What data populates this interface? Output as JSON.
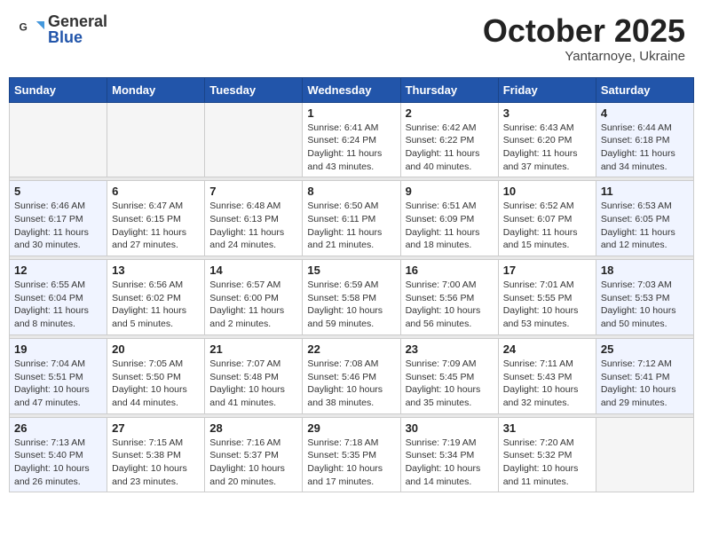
{
  "header": {
    "logo_general": "General",
    "logo_blue": "Blue",
    "month_title": "October 2025",
    "subtitle": "Yantarnoye, Ukraine"
  },
  "days_of_week": [
    "Sunday",
    "Monday",
    "Tuesday",
    "Wednesday",
    "Thursday",
    "Friday",
    "Saturday"
  ],
  "weeks": [
    [
      {
        "day": "",
        "info": ""
      },
      {
        "day": "",
        "info": ""
      },
      {
        "day": "",
        "info": ""
      },
      {
        "day": "1",
        "info": "Sunrise: 6:41 AM\nSunset: 6:24 PM\nDaylight: 11 hours\nand 43 minutes."
      },
      {
        "day": "2",
        "info": "Sunrise: 6:42 AM\nSunset: 6:22 PM\nDaylight: 11 hours\nand 40 minutes."
      },
      {
        "day": "3",
        "info": "Sunrise: 6:43 AM\nSunset: 6:20 PM\nDaylight: 11 hours\nand 37 minutes."
      },
      {
        "day": "4",
        "info": "Sunrise: 6:44 AM\nSunset: 6:18 PM\nDaylight: 11 hours\nand 34 minutes."
      }
    ],
    [
      {
        "day": "5",
        "info": "Sunrise: 6:46 AM\nSunset: 6:17 PM\nDaylight: 11 hours\nand 30 minutes."
      },
      {
        "day": "6",
        "info": "Sunrise: 6:47 AM\nSunset: 6:15 PM\nDaylight: 11 hours\nand 27 minutes."
      },
      {
        "day": "7",
        "info": "Sunrise: 6:48 AM\nSunset: 6:13 PM\nDaylight: 11 hours\nand 24 minutes."
      },
      {
        "day": "8",
        "info": "Sunrise: 6:50 AM\nSunset: 6:11 PM\nDaylight: 11 hours\nand 21 minutes."
      },
      {
        "day": "9",
        "info": "Sunrise: 6:51 AM\nSunset: 6:09 PM\nDaylight: 11 hours\nand 18 minutes."
      },
      {
        "day": "10",
        "info": "Sunrise: 6:52 AM\nSunset: 6:07 PM\nDaylight: 11 hours\nand 15 minutes."
      },
      {
        "day": "11",
        "info": "Sunrise: 6:53 AM\nSunset: 6:05 PM\nDaylight: 11 hours\nand 12 minutes."
      }
    ],
    [
      {
        "day": "12",
        "info": "Sunrise: 6:55 AM\nSunset: 6:04 PM\nDaylight: 11 hours\nand 8 minutes."
      },
      {
        "day": "13",
        "info": "Sunrise: 6:56 AM\nSunset: 6:02 PM\nDaylight: 11 hours\nand 5 minutes."
      },
      {
        "day": "14",
        "info": "Sunrise: 6:57 AM\nSunset: 6:00 PM\nDaylight: 11 hours\nand 2 minutes."
      },
      {
        "day": "15",
        "info": "Sunrise: 6:59 AM\nSunset: 5:58 PM\nDaylight: 10 hours\nand 59 minutes."
      },
      {
        "day": "16",
        "info": "Sunrise: 7:00 AM\nSunset: 5:56 PM\nDaylight: 10 hours\nand 56 minutes."
      },
      {
        "day": "17",
        "info": "Sunrise: 7:01 AM\nSunset: 5:55 PM\nDaylight: 10 hours\nand 53 minutes."
      },
      {
        "day": "18",
        "info": "Sunrise: 7:03 AM\nSunset: 5:53 PM\nDaylight: 10 hours\nand 50 minutes."
      }
    ],
    [
      {
        "day": "19",
        "info": "Sunrise: 7:04 AM\nSunset: 5:51 PM\nDaylight: 10 hours\nand 47 minutes."
      },
      {
        "day": "20",
        "info": "Sunrise: 7:05 AM\nSunset: 5:50 PM\nDaylight: 10 hours\nand 44 minutes."
      },
      {
        "day": "21",
        "info": "Sunrise: 7:07 AM\nSunset: 5:48 PM\nDaylight: 10 hours\nand 41 minutes."
      },
      {
        "day": "22",
        "info": "Sunrise: 7:08 AM\nSunset: 5:46 PM\nDaylight: 10 hours\nand 38 minutes."
      },
      {
        "day": "23",
        "info": "Sunrise: 7:09 AM\nSunset: 5:45 PM\nDaylight: 10 hours\nand 35 minutes."
      },
      {
        "day": "24",
        "info": "Sunrise: 7:11 AM\nSunset: 5:43 PM\nDaylight: 10 hours\nand 32 minutes."
      },
      {
        "day": "25",
        "info": "Sunrise: 7:12 AM\nSunset: 5:41 PM\nDaylight: 10 hours\nand 29 minutes."
      }
    ],
    [
      {
        "day": "26",
        "info": "Sunrise: 7:13 AM\nSunset: 5:40 PM\nDaylight: 10 hours\nand 26 minutes."
      },
      {
        "day": "27",
        "info": "Sunrise: 7:15 AM\nSunset: 5:38 PM\nDaylight: 10 hours\nand 23 minutes."
      },
      {
        "day": "28",
        "info": "Sunrise: 7:16 AM\nSunset: 5:37 PM\nDaylight: 10 hours\nand 20 minutes."
      },
      {
        "day": "29",
        "info": "Sunrise: 7:18 AM\nSunset: 5:35 PM\nDaylight: 10 hours\nand 17 minutes."
      },
      {
        "day": "30",
        "info": "Sunrise: 7:19 AM\nSunset: 5:34 PM\nDaylight: 10 hours\nand 14 minutes."
      },
      {
        "day": "31",
        "info": "Sunrise: 7:20 AM\nSunset: 5:32 PM\nDaylight: 10 hours\nand 11 minutes."
      },
      {
        "day": "",
        "info": ""
      }
    ]
  ]
}
